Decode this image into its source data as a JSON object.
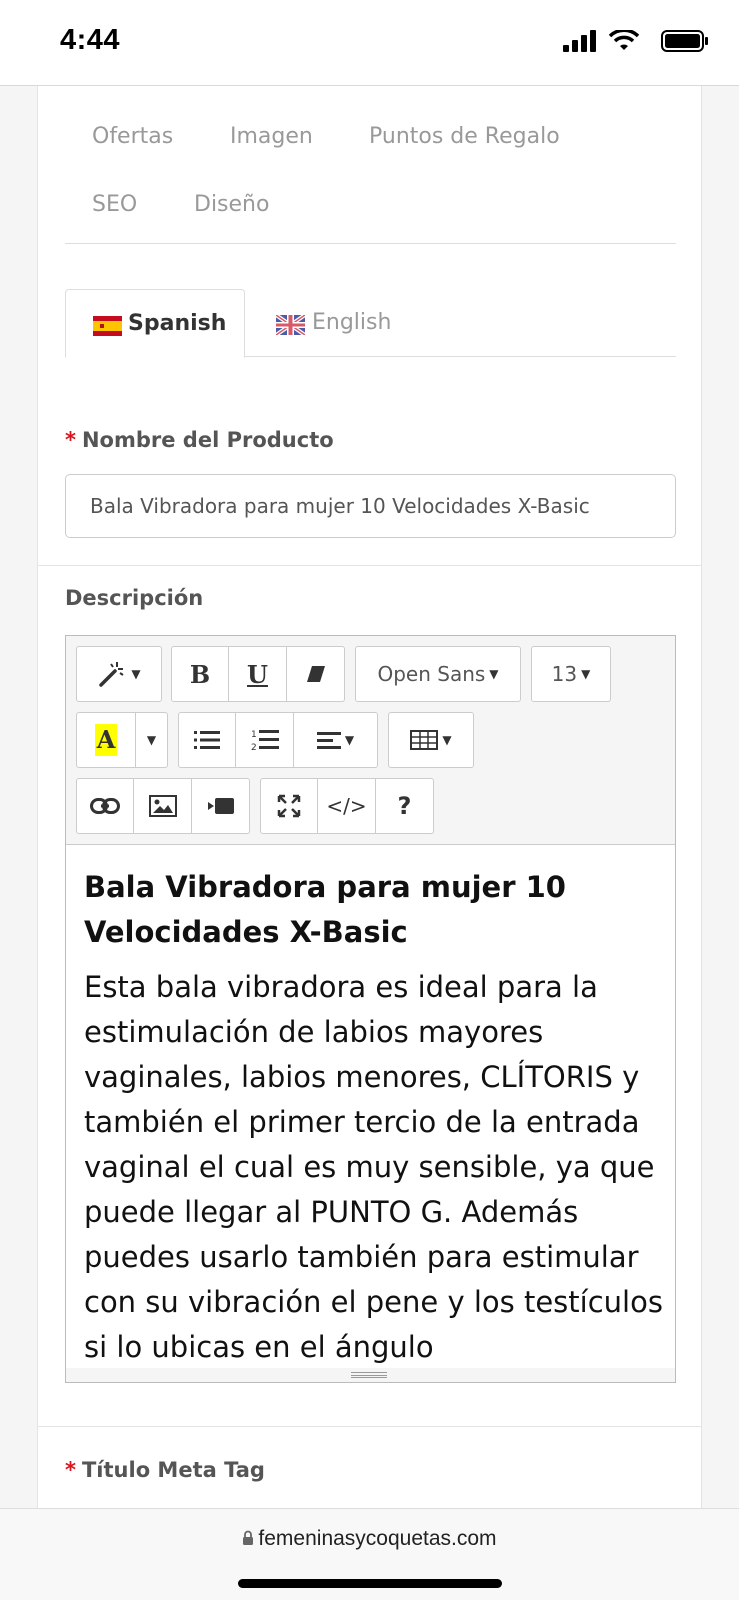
{
  "status_bar": {
    "time": "4:44"
  },
  "nav_tabs": [
    "Ofertas",
    "Imagen",
    "Puntos de Regalo",
    "SEO",
    "Diseño"
  ],
  "language_tabs": [
    {
      "label": "Spanish",
      "active": true
    },
    {
      "label": "English",
      "active": false
    }
  ],
  "product_name": {
    "required_mark": "*",
    "label": "Nombre del Producto",
    "value": "Bala Vibradora para mujer 10 Velocidades X-Basic"
  },
  "description": {
    "label": "Descripción",
    "toolbar": {
      "font_family": "Open Sans",
      "font_size": "13",
      "bold": "B",
      "underline": "U",
      "font_color": "A",
      "code_view": "</>",
      "help": "?"
    },
    "content_title": "Bala Vibradora para mujer 10 Velocidades X-Basic",
    "content_text": "Esta bala vibradora es ideal para la estimulación de labios mayores vaginales, labios menores, CLÍTORIS y también el primer tercio de la entrada vaginal el cual es muy sensible, ya que puede llegar al PUNTO G. Además puedes usarlo también para estimular con su vibración el pene y los testículos si lo ubicas en el ángulo"
  },
  "meta_title": {
    "required_mark": "*",
    "label": "Título Meta Tag"
  },
  "url_bar": {
    "domain": "femeninasycoquetas.com"
  },
  "colors": {
    "required": "#d9141c",
    "highlight": "#ffff00",
    "muted_text": "#999999"
  },
  "icons": [
    "signal-icon",
    "wifi-icon",
    "battery-icon",
    "magic-wand-icon",
    "eraser-icon",
    "unordered-list-icon",
    "ordered-list-icon",
    "align-icon",
    "table-icon",
    "link-icon",
    "picture-icon",
    "video-icon",
    "fullscreen-icon",
    "lock-icon"
  ]
}
